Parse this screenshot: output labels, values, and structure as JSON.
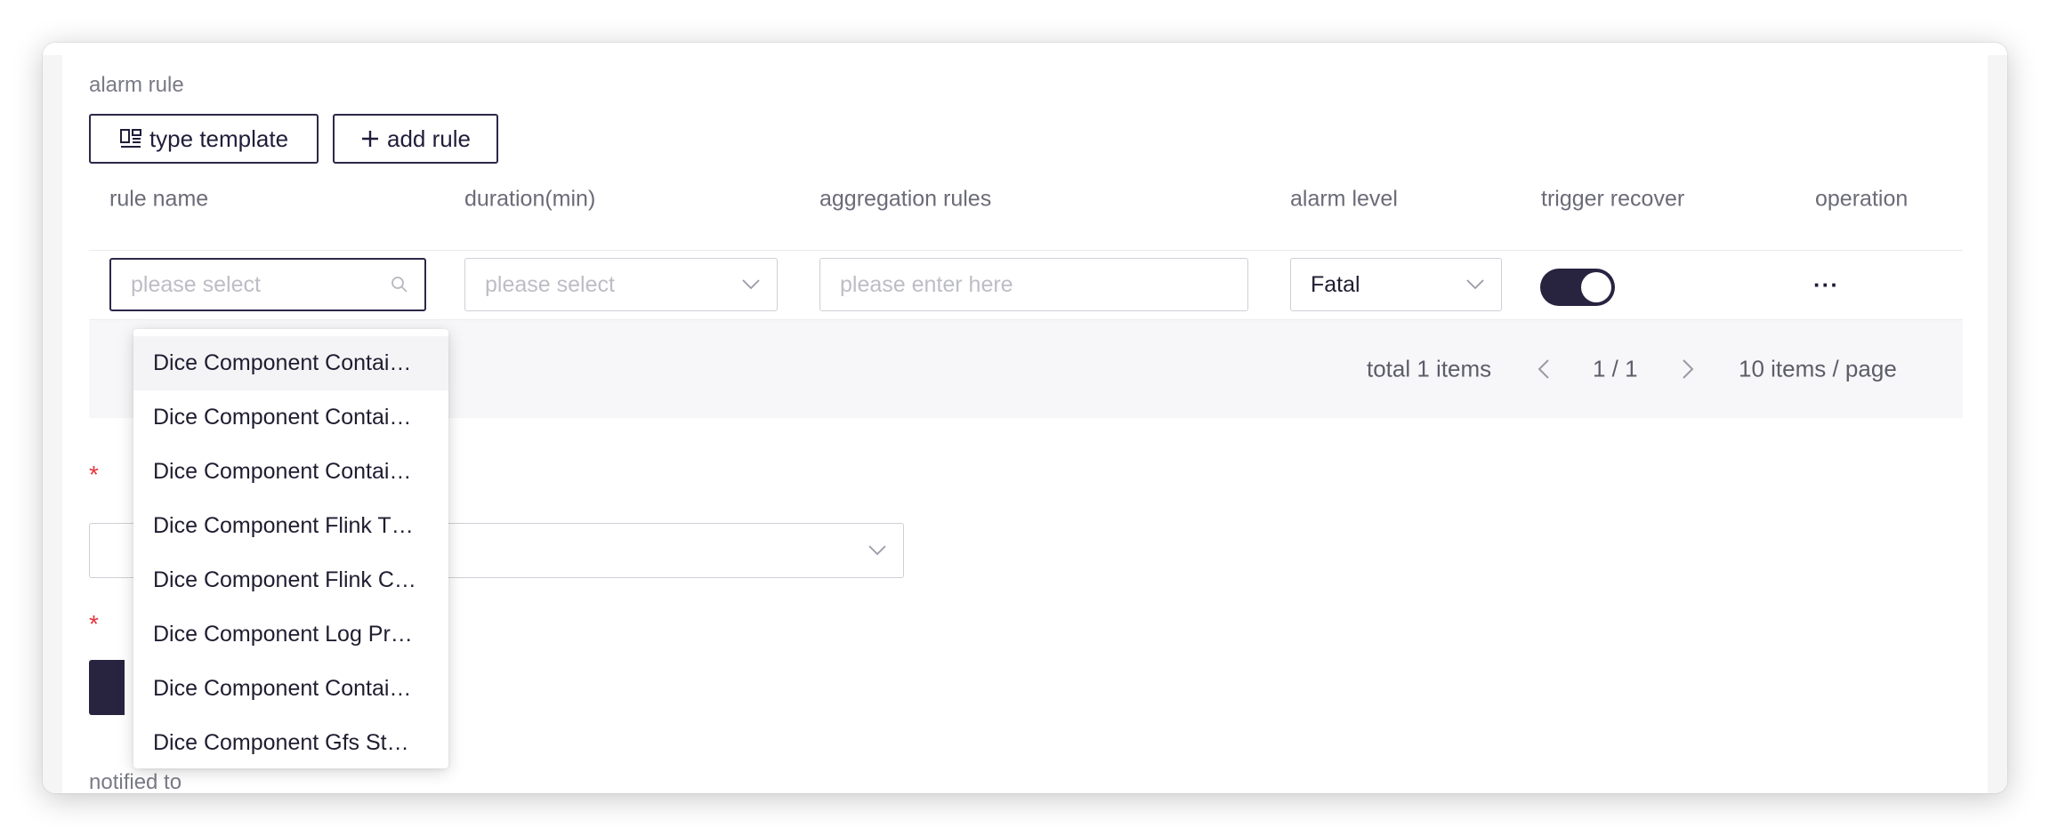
{
  "section": {
    "alarm_rule_label": "alarm rule",
    "notified_to_label": "notified to"
  },
  "toolbar": {
    "type_template_label": "type template",
    "add_rule_label": "add rule"
  },
  "table": {
    "columns": [
      "rule name",
      "duration(min)",
      "aggregation rules",
      "alarm level",
      "trigger recover",
      "operation"
    ],
    "row": {
      "rule_name_placeholder": "please select",
      "duration_placeholder": "please select",
      "aggregation_placeholder": "please enter here",
      "alarm_level_value": "Fatal",
      "trigger_recover_on": true,
      "operation_more": "···"
    }
  },
  "pagination": {
    "total_text": "total 1 items",
    "page_text": "1 / 1",
    "page_size_text": "10 items / page"
  },
  "form": {
    "required_mark": "*"
  },
  "dropdown": {
    "options": [
      "Dice Component Contai…",
      "Dice Component Contai…",
      "Dice Component Contai…",
      "Dice Component Flink T…",
      "Dice Component Flink C…",
      "Dice Component Log Pr…",
      "Dice Component Contai…",
      "Dice Component Gfs St…"
    ],
    "active_index": 0
  },
  "colors": {
    "primary": "#28233f",
    "required": "#e5363d",
    "pager_bg": "#f7f7f9"
  }
}
